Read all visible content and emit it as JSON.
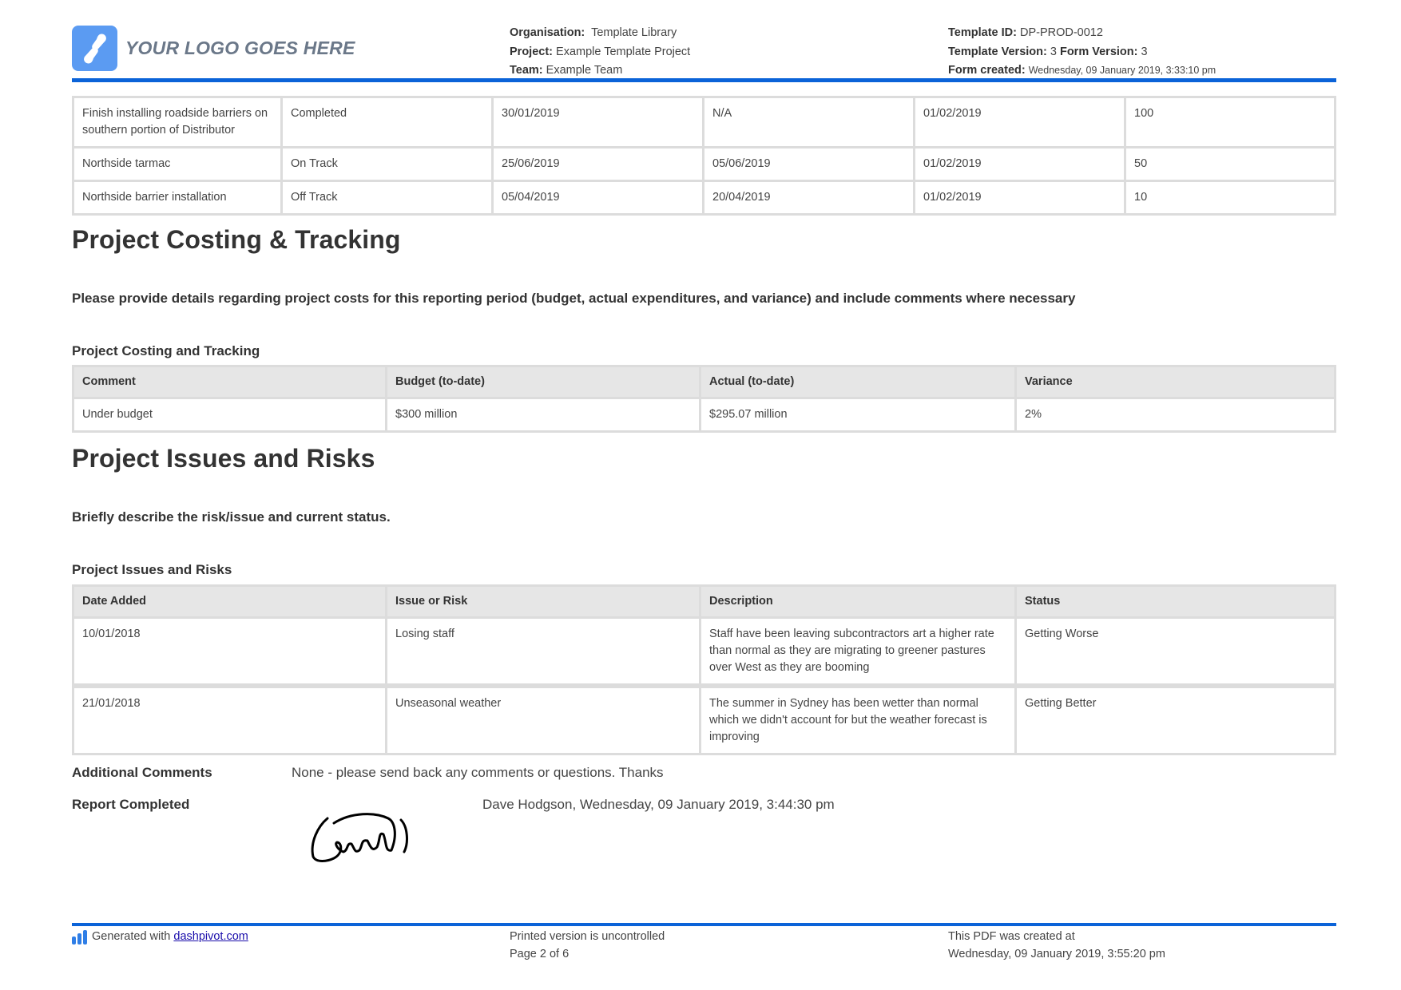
{
  "header": {
    "logo_text": "YOUR LOGO GOES HERE",
    "organisation_label": "Organisation:",
    "organisation_value": "Template Library",
    "project_label": "Project:",
    "project_value": "Example Template Project",
    "team_label": "Team:",
    "team_value": "Example Team",
    "template_id_label": "Template ID:",
    "template_id_value": "DP-PROD-0012",
    "template_version_label": "Template Version:",
    "template_version_value": "3",
    "form_version_label": "Form Version:",
    "form_version_value": "3",
    "form_created_label": "Form created:",
    "form_created_value": "Wednesday, 09 January 2019, 3:33:10 pm"
  },
  "milestones_table": {
    "rows": [
      [
        "Finish installing roadside barriers on southern portion of Distributor",
        "Completed",
        "30/01/2019",
        "N/A",
        "01/02/2019",
        "100"
      ],
      [
        "Northside tarmac",
        "On Track",
        "25/06/2019",
        "05/06/2019",
        "01/02/2019",
        "50"
      ],
      [
        "Northside barrier installation",
        "Off Track",
        "05/04/2019",
        "20/04/2019",
        "01/02/2019",
        "10"
      ]
    ]
  },
  "costing": {
    "heading": "Project Costing & Tracking",
    "instruction": "Please provide details regarding project costs for this reporting period (budget, actual expenditures, and variance) and include comments where necessary",
    "table_title": "Project Costing and Tracking",
    "columns": [
      "Comment",
      "Budget (to-date)",
      "Actual (to-date)",
      "Variance"
    ],
    "rows": [
      [
        "Under budget",
        "$300 million",
        "$295.07 million",
        "2%"
      ]
    ]
  },
  "issues": {
    "heading": "Project Issues and Risks",
    "instruction": "Briefly describe the risk/issue and current status.",
    "table_title": "Project Issues and Risks",
    "columns": [
      "Date Added",
      "Issue or Risk",
      "Description",
      "Status"
    ],
    "rows": [
      [
        "10/01/2018",
        "Losing staff",
        "Staff have been leaving subcontractors art a higher rate than normal as they are migrating to greener pastures over West as they are booming",
        "Getting Worse"
      ],
      [
        "21/01/2018",
        "Unseasonal weather",
        "The summer in Sydney has been wetter than normal which we didn't account for but the weather forecast is improving",
        "Getting Better"
      ]
    ]
  },
  "additional_comments": {
    "label": "Additional Comments",
    "value": "None - please send back any comments or questions. Thanks"
  },
  "report_completed": {
    "label": "Report Completed",
    "value": "Dave Hodgson, Wednesday, 09 January 2019, 3:44:30 pm"
  },
  "footer": {
    "generated_prefix": "Generated with",
    "generated_link": "dashpivot.com",
    "uncontrolled": "Printed version is uncontrolled",
    "page": "Page 2 of 6",
    "pdf_created_label": "This PDF was created at",
    "pdf_created_value": "Wednesday, 09 January 2019, 3:55:20 pm"
  },
  "colors": {
    "accent_blue": "#0b63d8",
    "logo_blue": "#5b9bf2",
    "table_header_bg": "#e6e6e6",
    "table_border": "#dcdcdc"
  }
}
